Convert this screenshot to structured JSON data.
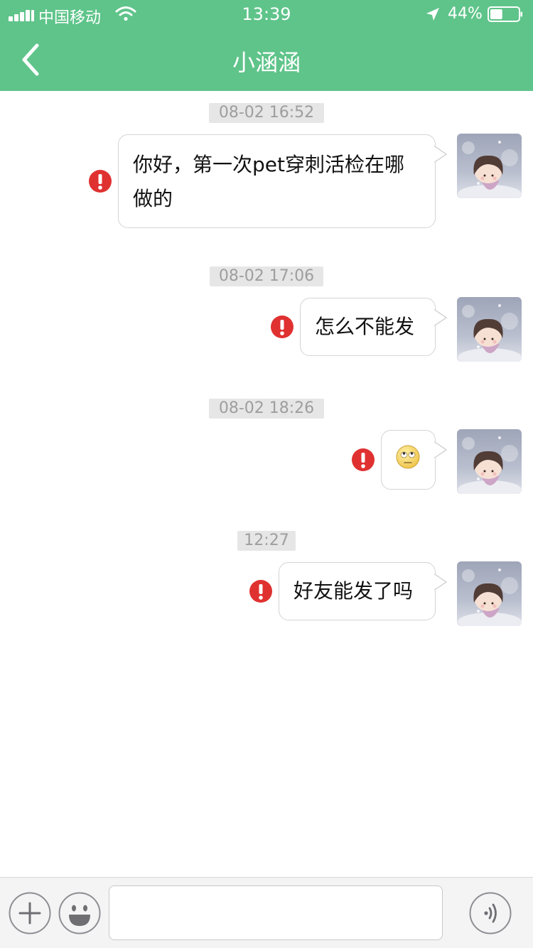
{
  "status_bar": {
    "carrier": "中国移动",
    "time": "13:39",
    "battery_percent": "44%",
    "battery_level": 0.44
  },
  "header": {
    "title": "小涵涵"
  },
  "messages": [
    {
      "timestamp": "08-02 16:52",
      "text_lines": [
        "你好，第一次pet穿刺活检在哪",
        "做的"
      ],
      "status": "failed"
    },
    {
      "timestamp": "08-02 17:06",
      "text": "怎么不能发",
      "status": "failed"
    },
    {
      "timestamp": "08-02 18:26",
      "emoji": "rolling-eyes-emoji",
      "status": "failed"
    },
    {
      "timestamp": "12:27",
      "text": "好友能发了吗",
      "status": "failed"
    }
  ],
  "input_bar": {
    "value": "",
    "placeholder": ""
  },
  "colors": {
    "accent": "#5fc48a",
    "error": "#e03131",
    "timestamp_bg": "#e6e6e6"
  },
  "icons": [
    "back-chevron-icon",
    "signal-icon",
    "wifi-icon",
    "location-arrow-icon",
    "battery-icon",
    "error-icon",
    "plus-icon",
    "smiley-icon",
    "voice-icon"
  ]
}
